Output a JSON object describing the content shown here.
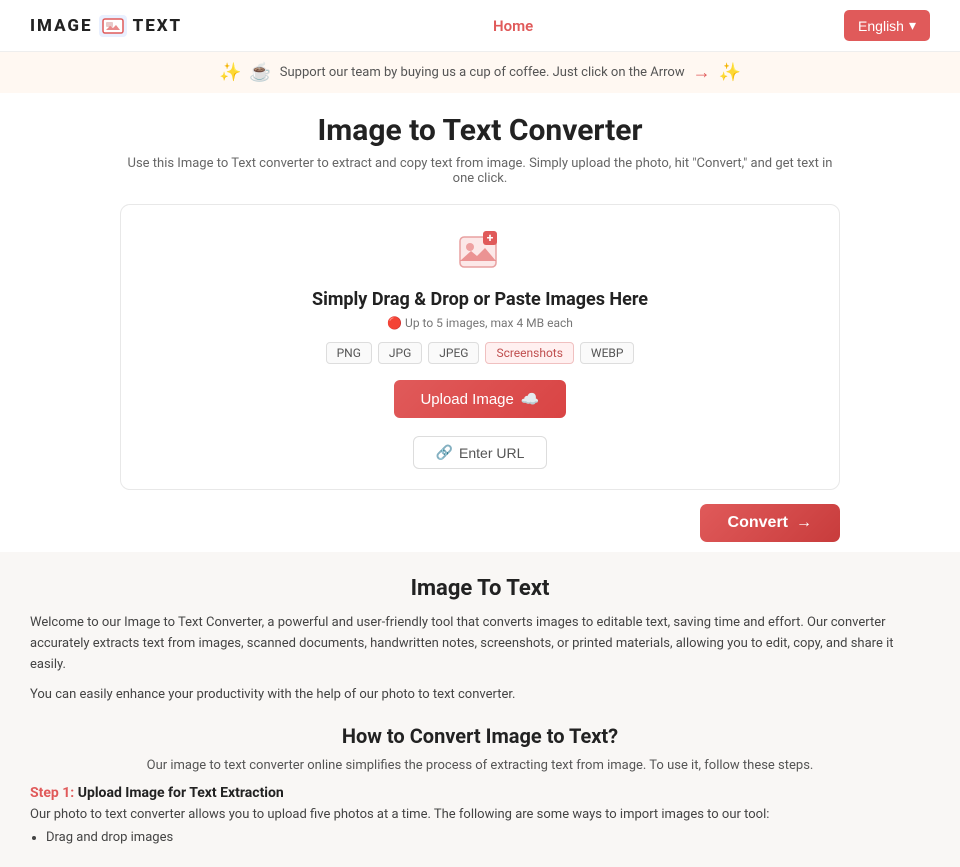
{
  "header": {
    "logo_text_1": "IMAGE",
    "logo_text_2": "TEXT",
    "nav_home": "Home",
    "lang_btn": "English",
    "lang_arrow": "▾"
  },
  "banner": {
    "text": "Support our team by buying us a cup of coffee. Just click on the Arrow",
    "emoji_left": "☕",
    "emoji_star": "✨",
    "arrow": "→"
  },
  "page": {
    "title": "Image to Text Converter",
    "subtitle": "Use this Image to Text converter to extract and copy text from image. Simply upload the photo, hit \"Convert,\" and get text in one click."
  },
  "upload": {
    "drag_title": "Simply Drag & Drop or Paste Images Here",
    "limit_icon": "🔴",
    "limit_text": "Up to 5 images, max 4 MB each",
    "formats": [
      "PNG",
      "JPG",
      "JPEG",
      "Screenshots",
      "WEBP"
    ],
    "upload_btn": "Upload Image",
    "url_btn": "Enter URL"
  },
  "convert": {
    "btn_label": "Convert",
    "btn_arrow": "→"
  },
  "info": {
    "title": "Image To Text",
    "desc1": "Welcome to our Image to Text Converter, a powerful and user-friendly tool that converts images to editable text, saving time and effort. Our converter accurately extracts text from images, scanned documents, handwritten notes, screenshots, or printed materials, allowing you to edit, copy, and share it easily.",
    "desc2": "You can easily enhance your productivity with the help of our photo to text converter.",
    "howto_title": "How to Convert Image to Text?",
    "howto_sub": "Our image to text converter online simplifies the process of extracting text from image. To use it, follow these steps.",
    "step1_label": "Step 1:",
    "step1_title": "Upload Image for Text Extraction",
    "step1_desc": "Our photo to text converter allows you to upload five photos at a time. The following are some ways to import images to our tool:",
    "step1_list_item": "Drag and drop images"
  }
}
